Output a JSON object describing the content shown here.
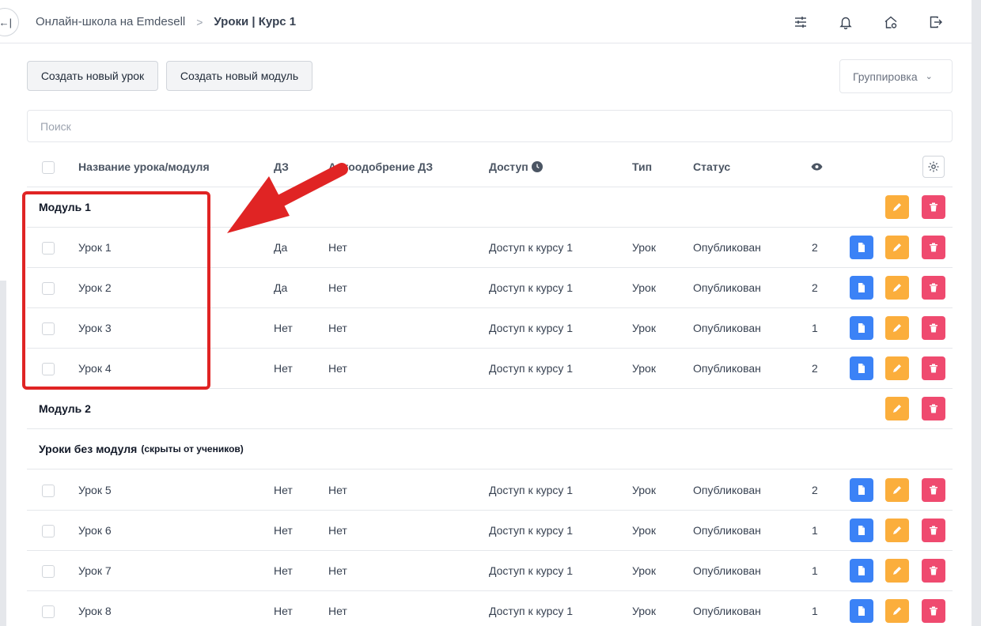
{
  "topbar": {
    "collapse_icon": "collapse-left-icon",
    "breadcrumb": [
      "Онлайн-школа на Emdesell",
      "Уроки | Курс 1"
    ],
    "breadcrumb_separator": ">",
    "icons": [
      "sliders-icon",
      "bell-icon",
      "home-settings-icon",
      "logout-icon"
    ]
  },
  "toolbar": {
    "create_lesson": "Создать новый урок",
    "create_module": "Создать новый модуль",
    "grouping": "Группировка"
  },
  "search": {
    "placeholder": "Поиск"
  },
  "table": {
    "headers": {
      "name": "Название урока/модуля",
      "hw": "ДЗ",
      "auto": "Автоодобрение ДЗ",
      "access": "Доступ",
      "type": "Тип",
      "status": "Статус"
    },
    "modules": [
      {
        "title": "Модуль 1",
        "lessons": [
          {
            "name": "Урок 1",
            "hw": "Да",
            "auto": "Нет",
            "access": "Доступ к курсу 1",
            "type": "Урок",
            "status": "Опубликован",
            "views": "2"
          },
          {
            "name": "Урок 2",
            "hw": "Да",
            "auto": "Нет",
            "access": "Доступ к курсу 1",
            "type": "Урок",
            "status": "Опубликован",
            "views": "2"
          },
          {
            "name": "Урок 3",
            "hw": "Нет",
            "auto": "Нет",
            "access": "Доступ к курсу 1",
            "type": "Урок",
            "status": "Опубликован",
            "views": "1"
          },
          {
            "name": "Урок 4",
            "hw": "Нет",
            "auto": "Нет",
            "access": "Доступ к курсу 1",
            "type": "Урок",
            "status": "Опубликован",
            "views": "2"
          }
        ]
      },
      {
        "title": "Модуль 2",
        "lessons": []
      }
    ],
    "no_module": {
      "title": "Уроки без модуля",
      "subtitle": "(скрыты от учеников)",
      "lessons": [
        {
          "name": "Урок 5",
          "hw": "Нет",
          "auto": "Нет",
          "access": "Доступ к курсу 1",
          "type": "Урок",
          "status": "Опубликован",
          "views": "2"
        },
        {
          "name": "Урок 6",
          "hw": "Нет",
          "auto": "Нет",
          "access": "Доступ к курсу 1",
          "type": "Урок",
          "status": "Опубликован",
          "views": "1"
        },
        {
          "name": "Урок 7",
          "hw": "Нет",
          "auto": "Нет",
          "access": "Доступ к курсу 1",
          "type": "Урок",
          "status": "Опубликован",
          "views": "1"
        },
        {
          "name": "Урок 8",
          "hw": "Нет",
          "auto": "Нет",
          "access": "Доступ к курсу 1",
          "type": "Урок",
          "status": "Опубликован",
          "views": "1"
        }
      ]
    }
  },
  "colors": {
    "blue": "#3b82f6",
    "orange": "#fbae3c",
    "red": "#ef4a6f",
    "annotation": "#e02424"
  }
}
